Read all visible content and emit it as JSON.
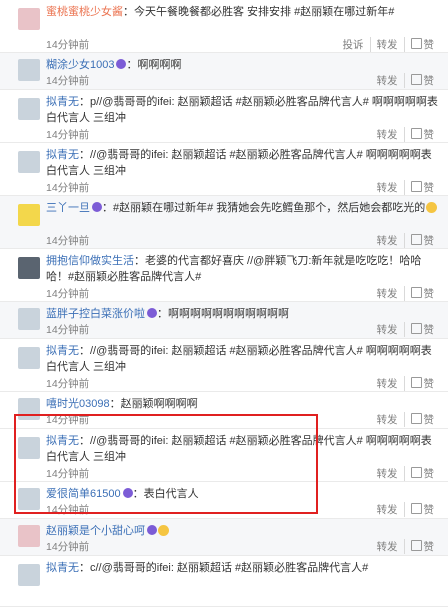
{
  "comments": [
    {
      "user": "蜜桃蜜桃少女酱",
      "text": "：今天午餐晚餐都必胜客 安排安排 #赵丽颖在哪过新年#",
      "time": "14分钟前",
      "actions": [
        "投诉",
        "转发",
        "赞"
      ]
    },
    {
      "user": "糊涂少女1003",
      "text": "：啊啊啊啊",
      "time": "14分钟前",
      "actions": [
        "转发",
        "赞"
      ]
    },
    {
      "user": "拟青无",
      "text": "：p//@翡哥哥的ifei: 赵丽颖超话 #赵丽颖必胜客品牌代言人# 啊啊啊啊啊表白代言人 三组冲",
      "time": "14分钟前",
      "actions": [
        "转发",
        "赞"
      ]
    },
    {
      "user": "拟青无",
      "text": "：//@翡哥哥的ifei: 赵丽颖超话 #赵丽颖必胜客品牌代言人# 啊啊啊啊啊表白代言人 三组冲",
      "time": "14分钟前",
      "actions": [
        "转发",
        "赞"
      ]
    },
    {
      "user": "三丫一旦",
      "text": "：#赵丽颖在哪过新年# 我猜她会先吃鳕鱼那个，然后她会都吃光的",
      "time": "14分钟前",
      "actions": [
        "转发",
        "赞"
      ]
    },
    {
      "user": "拥抱信仰做实生活",
      "text": "：老婆的代言都好喜庆 //@胖颖飞刀:新年就是吃吃吃！哈哈哈！#赵丽颖必胜客品牌代言人#",
      "time": "14分钟前",
      "actions": [
        "转发",
        "赞"
      ]
    },
    {
      "user": "蓝胖子控白菜涨价啦",
      "text": "：啊啊啊啊啊啊啊啊啊啊啊",
      "time": "14分钟前",
      "actions": [
        "转发",
        "赞"
      ]
    },
    {
      "user": "拟青无",
      "text": "：//@翡哥哥的ifei: 赵丽颖超话 #赵丽颖必胜客品牌代言人# 啊啊啊啊啊表白代言人 三组冲",
      "time": "14分钟前",
      "actions": [
        "转发",
        "赞"
      ]
    },
    {
      "user": "嘻时光03098",
      "text": "：赵丽颖啊啊啊啊",
      "time": "14分钟前",
      "actions": [
        "转发",
        "赞"
      ]
    },
    {
      "user": "拟青无",
      "text": "：//@翡哥哥的ifei: 赵丽颖超话 #赵丽颖必胜客品牌代言人# 啊啊啊啊啊表白代言人 三组冲",
      "time": "14分钟前",
      "actions": [
        "转发",
        "赞"
      ]
    },
    {
      "user": "爱很简单61500",
      "text": "：表白代言人",
      "time": "14分钟前",
      "actions": [
        "转发",
        "赞"
      ]
    },
    {
      "user": "赵丽颖是个小甜心呵",
      "text": "",
      "time": "14分钟前",
      "actions": [
        "转发",
        "赞"
      ]
    },
    {
      "user": "拟青无",
      "text": "：c//@翡哥哥的ifei: 赵丽颖超话 #赵丽颖必胜客品牌代言人#",
      "time": "",
      "actions": []
    }
  ]
}
